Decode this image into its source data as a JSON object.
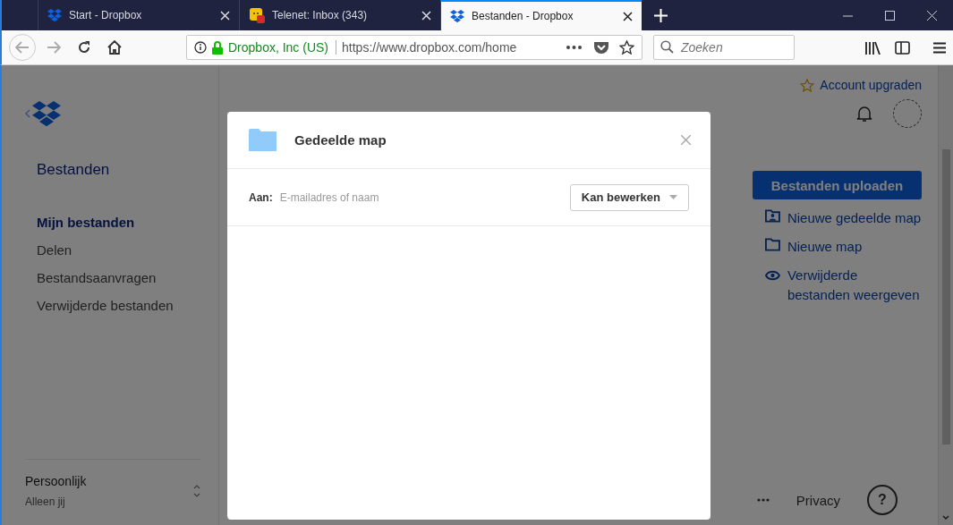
{
  "tabs": [
    {
      "title": "Start - Dropbox",
      "selected": false
    },
    {
      "title": "Telenet: Inbox (343)",
      "selected": false
    },
    {
      "title": "Bestanden - Dropbox",
      "selected": true
    }
  ],
  "toolbar": {
    "identity": "Dropbox, Inc (US)",
    "url": "https://www.dropbox.com/home",
    "search_placeholder": "Zoeken"
  },
  "sidebar": {
    "title": "Bestanden",
    "items": [
      {
        "label": "Mijn bestanden",
        "selected": true
      },
      {
        "label": "Delen",
        "selected": false
      },
      {
        "label": "Bestandsaanvragen",
        "selected": false
      },
      {
        "label": "Verwijderde bestanden",
        "selected": false
      }
    ],
    "account": {
      "name": "Persoonlijk",
      "subtitle": "Alleen jij"
    }
  },
  "header": {
    "upgrade": "Account upgraden"
  },
  "actions": {
    "upload": "Bestanden uploaden",
    "links": [
      {
        "label": "Nieuwe gedeelde map",
        "kind": "shared-folder"
      },
      {
        "label": "Nieuwe map",
        "kind": "folder"
      },
      {
        "label": "Verwijderde bestanden weergeven",
        "kind": "eye"
      }
    ]
  },
  "footer": {
    "privacy": "Privacy",
    "help": "?"
  },
  "dialog": {
    "title": "Gedeelde map",
    "to_label": "Aan:",
    "to_placeholder": "E-mailadres of naam",
    "permission": "Kan bewerken"
  }
}
